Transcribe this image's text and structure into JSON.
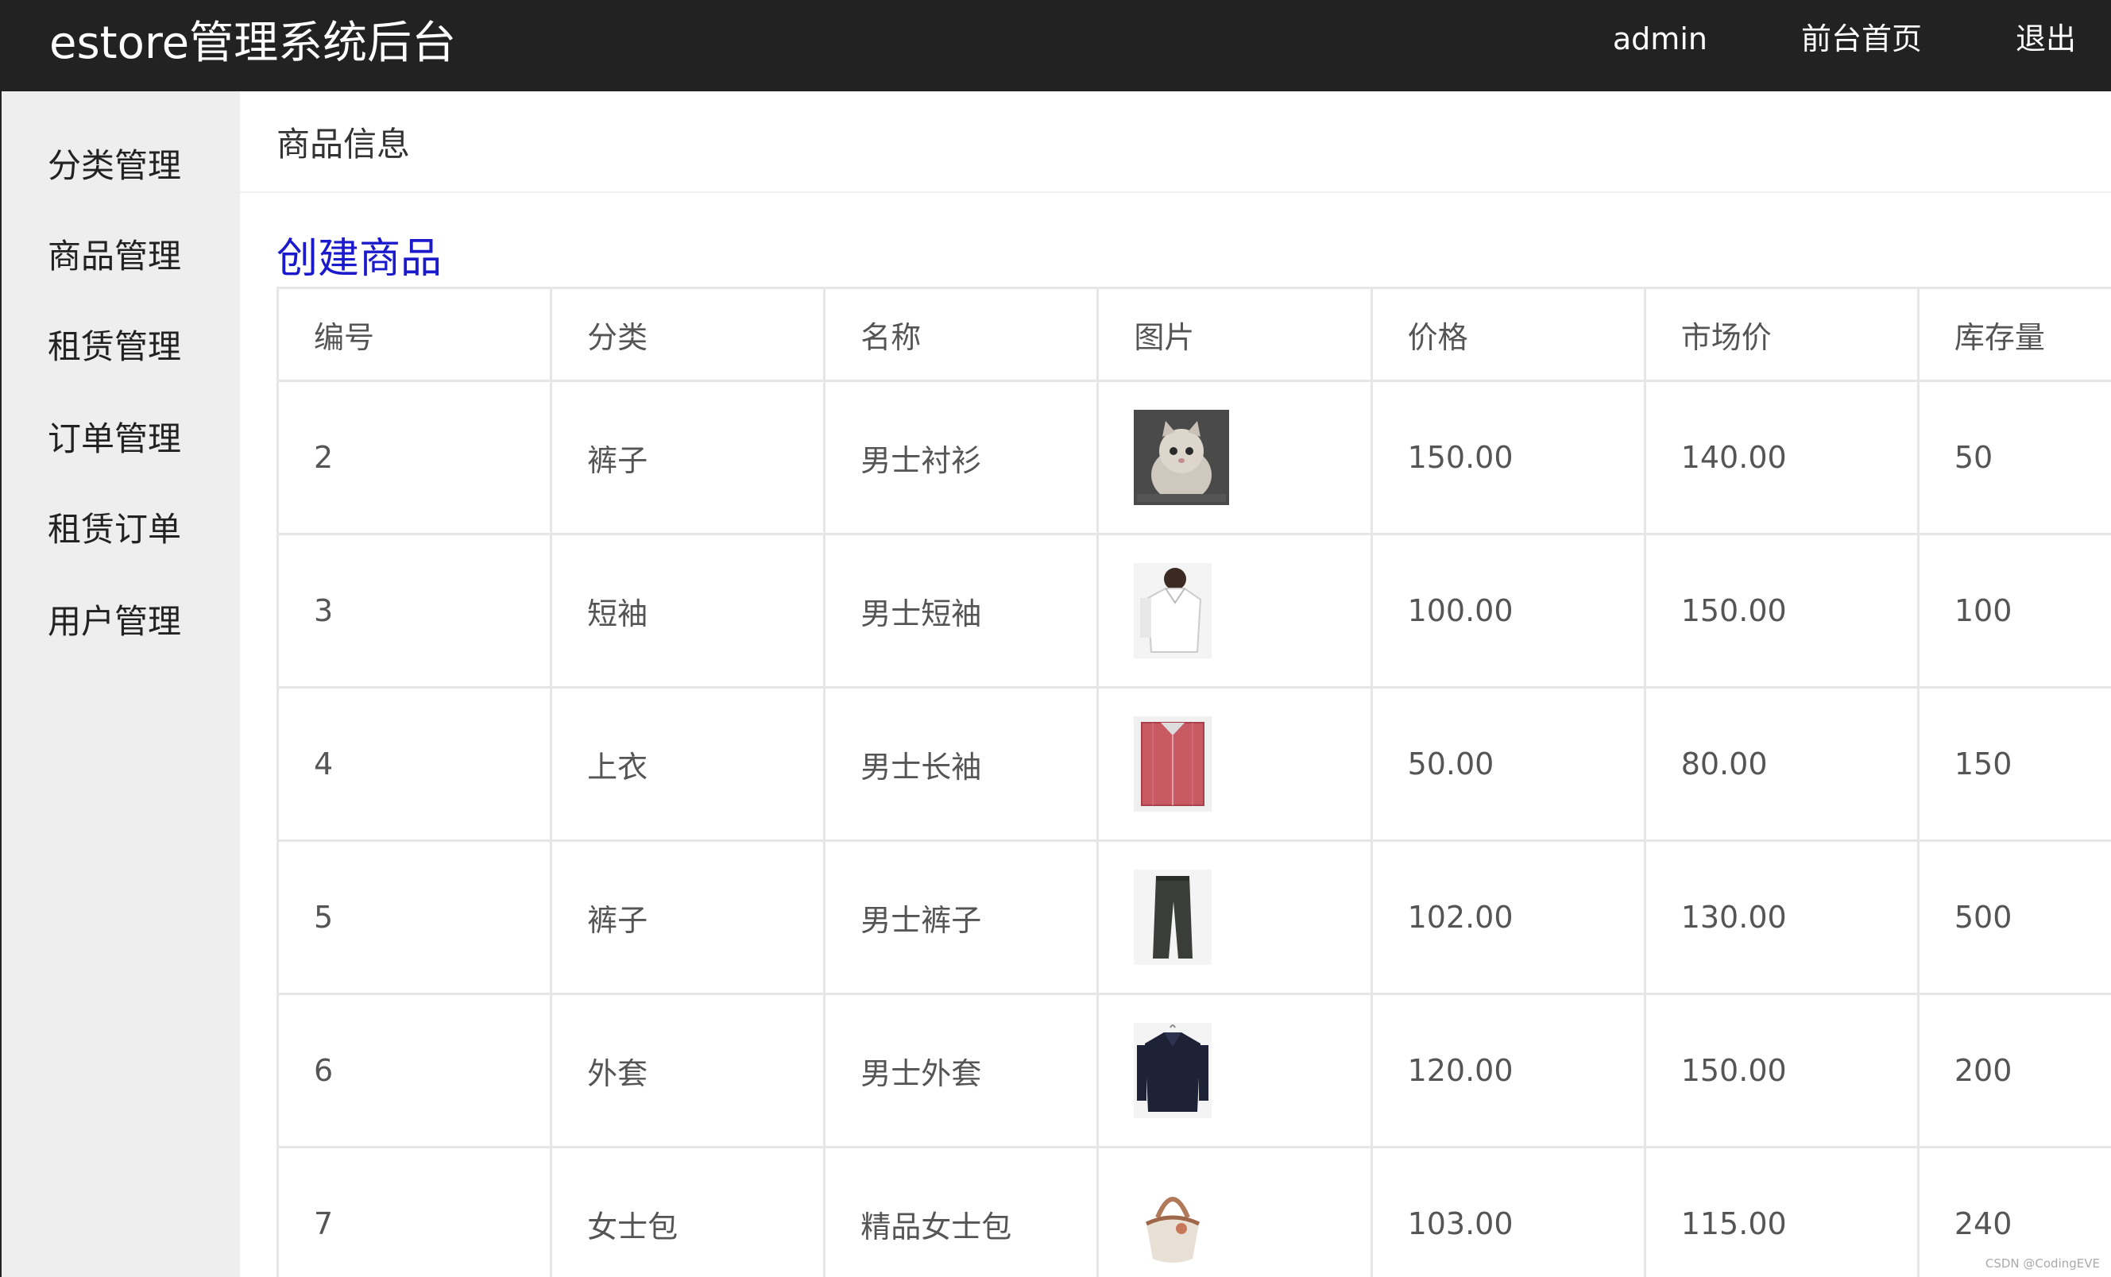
{
  "header": {
    "brand": "estore管理系统后台",
    "nav": [
      "admin",
      "前台首页",
      "退出"
    ]
  },
  "sidebar": {
    "items": [
      "分类管理",
      "商品管理",
      "租赁管理",
      "订单管理",
      "租赁订单",
      "用户管理"
    ]
  },
  "main": {
    "heading": "商品信息",
    "create_link": "创建商品",
    "table": {
      "columns": [
        "编号",
        "分类",
        "名称",
        "图片",
        "价格",
        "市场价",
        "库存量"
      ],
      "rows": [
        {
          "id": "2",
          "category": "裤子",
          "name": "男士衬衫",
          "image": "kitten-photo",
          "price": "150.00",
          "market_price": "140.00",
          "stock": "50"
        },
        {
          "id": "3",
          "category": "短袖",
          "name": "男士短袖",
          "image": "white-shirt-photo",
          "price": "100.00",
          "market_price": "150.00",
          "stock": "100"
        },
        {
          "id": "4",
          "category": "上衣",
          "name": "男士长袖",
          "image": "red-shirt-photo",
          "price": "50.00",
          "market_price": "80.00",
          "stock": "150"
        },
        {
          "id": "5",
          "category": "裤子",
          "name": "男士裤子",
          "image": "dark-pants-photo",
          "price": "102.00",
          "market_price": "130.00",
          "stock": "500"
        },
        {
          "id": "6",
          "category": "外套",
          "name": "男士外套",
          "image": "navy-jacket-photo",
          "price": "120.00",
          "market_price": "150.00",
          "stock": "200"
        },
        {
          "id": "7",
          "category": "女士包",
          "name": "精品女士包",
          "image": "handbag-photo",
          "price": "103.00",
          "market_price": "115.00",
          "stock": "240"
        }
      ]
    }
  },
  "watermark": "CSDN @CodingEVE",
  "colors": {
    "header_bg": "#222222",
    "sidebar_bg": "#eeeeee",
    "link_blue": "#1a1acc",
    "border": "#e6e6e6"
  }
}
